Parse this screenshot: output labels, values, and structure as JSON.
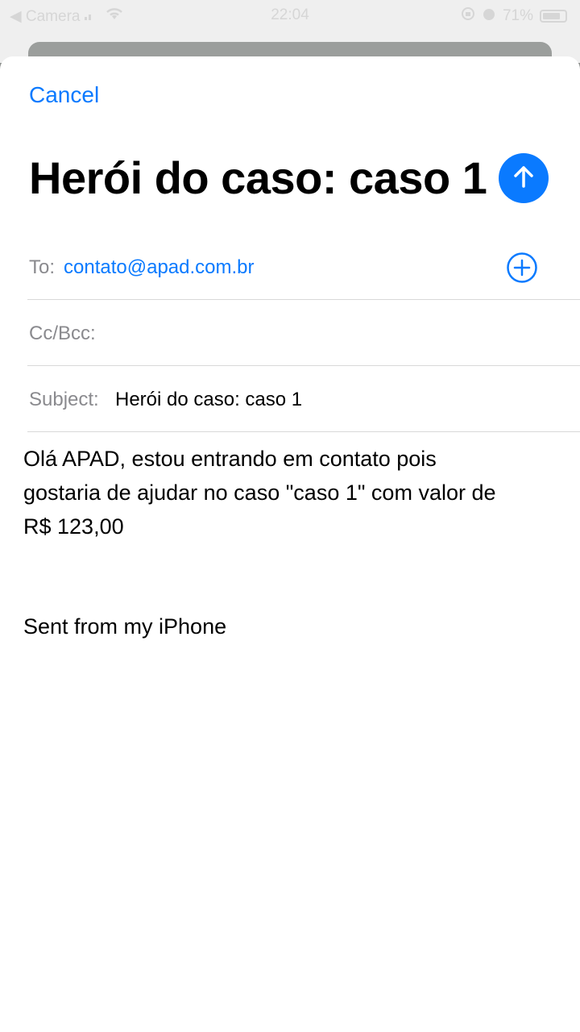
{
  "status_bar": {
    "back_label": "◀ Camera",
    "time": "22:04",
    "battery_percent": "71%"
  },
  "compose": {
    "cancel_label": "Cancel",
    "title": "Herói do caso: caso 1",
    "to_label": "To:",
    "to_value": "contato@apad.com.br",
    "cc_label": "Cc/Bcc:",
    "subject_label": "Subject:",
    "subject_value": "Herói do caso: caso 1",
    "body_line1": "Olá APAD, estou entrando em contato pois",
    "body_line2": "gostaria de ajudar no caso \"caso 1\" com valor de",
    "body_line3": "R$ 123,00",
    "signature": "Sent from my iPhone"
  },
  "colors": {
    "accent": "#0a7aff",
    "label_gray": "#8a8a8e"
  },
  "icons": {
    "send": "arrow-up-icon",
    "add_recipient": "plus-circle-icon"
  }
}
